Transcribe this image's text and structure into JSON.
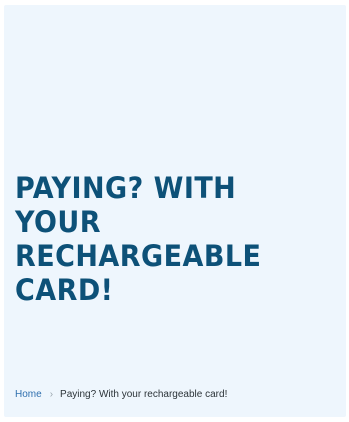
{
  "hero": {
    "title_lines": [
      "Paying? With",
      "your",
      "rechargeable",
      "card!"
    ]
  },
  "breadcrumb": {
    "home": "Home",
    "separator": "›",
    "current": "Paying? With your rechargeable card!"
  },
  "colors": {
    "hero_background": "#eef6fd",
    "title": "#0d5178",
    "link": "#2f6fae",
    "text": "#2b3338"
  }
}
